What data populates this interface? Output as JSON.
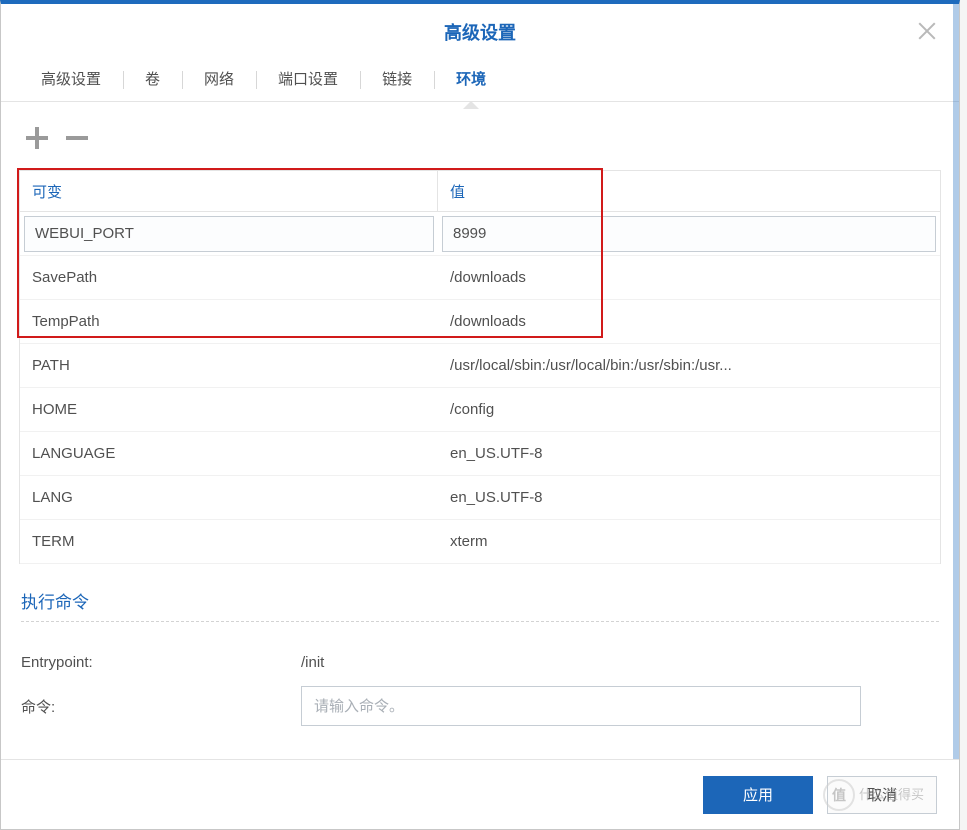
{
  "dialog": {
    "title": "高级设置"
  },
  "tabs": [
    {
      "label": "高级设置",
      "active": false
    },
    {
      "label": "卷",
      "active": false
    },
    {
      "label": "网络",
      "active": false
    },
    {
      "label": "端口设置",
      "active": false
    },
    {
      "label": "链接",
      "active": false
    },
    {
      "label": "环境",
      "active": true
    }
  ],
  "envTable": {
    "headers": {
      "variable": "可变",
      "value": "值"
    },
    "rows": [
      {
        "variable": "WEBUI_PORT",
        "value": "8999",
        "editing": true
      },
      {
        "variable": "SavePath",
        "value": "/downloads"
      },
      {
        "variable": "TempPath",
        "value": "/downloads"
      },
      {
        "variable": "PATH",
        "value": "/usr/local/sbin:/usr/local/bin:/usr/sbin:/usr..."
      },
      {
        "variable": "HOME",
        "value": "/config"
      },
      {
        "variable": "LANGUAGE",
        "value": "en_US.UTF-8"
      },
      {
        "variable": "LANG",
        "value": "en_US.UTF-8"
      },
      {
        "variable": "TERM",
        "value": "xterm"
      }
    ]
  },
  "execCommand": {
    "sectionTitle": "执行命令",
    "entrypointLabel": "Entrypoint:",
    "entrypointValue": "/init",
    "commandLabel": "命令:",
    "commandPlaceholder": "请输入命令。"
  },
  "footer": {
    "apply": "应用",
    "cancel": "取消"
  },
  "watermark": {
    "badge": "值",
    "text": "什么值得买"
  }
}
